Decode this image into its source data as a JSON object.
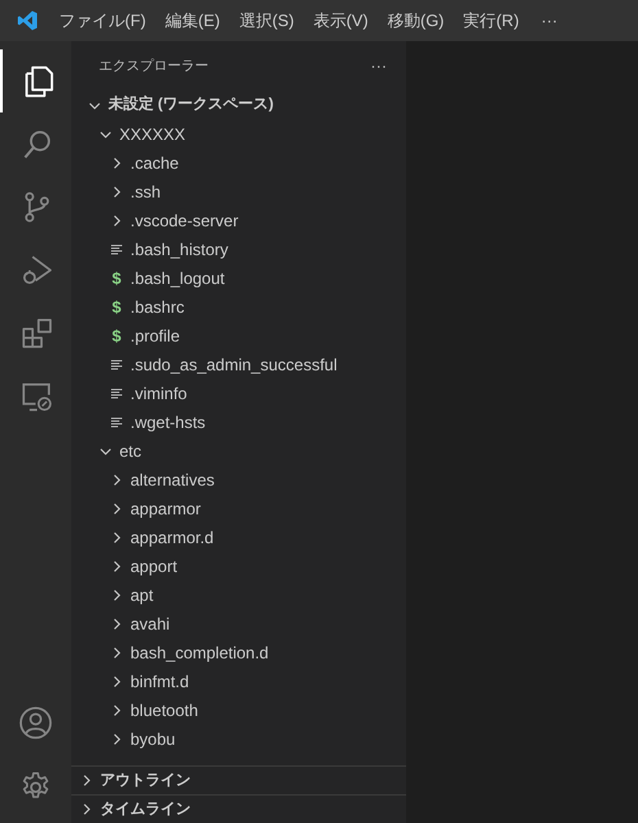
{
  "menu_bar": {
    "items": [
      "ファイル(F)",
      "編集(E)",
      "選択(S)",
      "表示(V)",
      "移動(G)",
      "実行(R)"
    ],
    "more": "···"
  },
  "activity_bar": {
    "items": [
      {
        "kind": "explorer",
        "selected": true
      },
      {
        "kind": "search",
        "selected": false
      },
      {
        "kind": "source-control",
        "selected": false
      },
      {
        "kind": "run",
        "selected": false
      },
      {
        "kind": "extensions",
        "selected": false
      },
      {
        "kind": "remote",
        "selected": false
      }
    ]
  },
  "sidebar": {
    "title": "エクスプローラー",
    "more": "···",
    "tree": [
      {
        "label": "未設定 (ワークスペース)",
        "kind": "folder",
        "expanded": true,
        "children": [
          {
            "label": "XXXXXX",
            "kind": "folder",
            "expanded": true,
            "children": [
              {
                "label": ".cache",
                "kind": "folder",
                "expanded": false
              },
              {
                "label": ".ssh",
                "kind": "folder",
                "expanded": false
              },
              {
                "label": ".vscode-server",
                "kind": "folder",
                "expanded": false
              },
              {
                "label": ".bash_history",
                "kind": "file"
              },
              {
                "label": ".bash_logout",
                "kind": "shell",
                "glyph": "$"
              },
              {
                "label": ".bashrc",
                "kind": "shell",
                "glyph": "$"
              },
              {
                "label": ".profile",
                "kind": "shell",
                "glyph": "$"
              },
              {
                "label": ".sudo_as_admin_successful",
                "kind": "file"
              },
              {
                "label": ".viminfo",
                "kind": "file"
              },
              {
                "label": ".wget-hsts",
                "kind": "file"
              }
            ]
          },
          {
            "label": "etc",
            "kind": "folder",
            "expanded": true,
            "children": [
              {
                "label": "alternatives",
                "kind": "folder",
                "expanded": false
              },
              {
                "label": "apparmor",
                "kind": "folder",
                "expanded": false
              },
              {
                "label": "apparmor.d",
                "kind": "folder",
                "expanded": false
              },
              {
                "label": "apport",
                "kind": "folder",
                "expanded": false
              },
              {
                "label": "apt",
                "kind": "folder",
                "expanded": false
              },
              {
                "label": "avahi",
                "kind": "folder",
                "expanded": false
              },
              {
                "label": "bash_completion.d",
                "kind": "folder",
                "expanded": false
              },
              {
                "label": "binfmt.d",
                "kind": "folder",
                "expanded": false
              },
              {
                "label": "bluetooth",
                "kind": "folder",
                "expanded": false
              },
              {
                "label": "byobu",
                "kind": "folder",
                "expanded": false
              }
            ]
          }
        ]
      }
    ],
    "sections": [
      {
        "label": "アウトライン",
        "expanded": false
      },
      {
        "label": "タイムライン",
        "expanded": false
      }
    ]
  }
}
